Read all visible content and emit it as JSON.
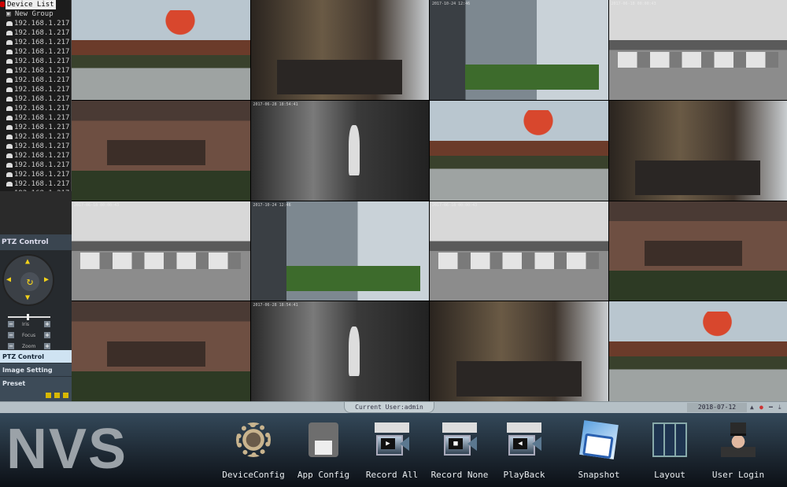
{
  "device_list": {
    "title": "Device List",
    "group": "New Group",
    "devices": [
      "192.168.1.217",
      "192.168.1.217",
      "192.168.1.217",
      "192.168.1.217",
      "192.168.1.217",
      "192.168.1.217",
      "192.168.1.217",
      "192.168.1.217",
      "192.168.1.217",
      "192.168.1.217",
      "192.168.1.217",
      "192.168.1.217",
      "192.168.1.217",
      "192.168.1.217",
      "192.168.1.217",
      "192.168.1.217",
      "192.168.1.217",
      "192.168.1.217",
      "192.168.1.217"
    ]
  },
  "ptz": {
    "header": "PTZ Control",
    "rows": [
      "Iris",
      "Focus",
      "Zoom"
    ],
    "tabs": [
      "PTZ Control",
      "Image Setting",
      "Preset"
    ]
  },
  "video_grid": {
    "tiles": [
      {
        "scene": "color-exterior"
      },
      {
        "scene": "color-lobby"
      },
      {
        "scene": "color-street",
        "timestamp": "2017-10-24 12:46"
      },
      {
        "scene": "ir-parking",
        "timestamp": "2017-06-18 00:00:43"
      },
      {
        "scene": "color-facade"
      },
      {
        "scene": "ir-office",
        "timestamp": "2017-06-28 18:54:41"
      },
      {
        "scene": "color-exterior"
      },
      {
        "scene": "color-lobby"
      },
      {
        "scene": "ir-parking",
        "timestamp": "2017-06-18 00:00:43"
      },
      {
        "scene": "color-street",
        "timestamp": "2017-10-24 12:46"
      },
      {
        "scene": "ir-parking",
        "timestamp": "2017-06-18 00:00:43"
      },
      {
        "scene": "color-facade"
      },
      {
        "scene": "color-facade"
      },
      {
        "scene": "ir-office",
        "timestamp": "2017-06-28 18:54:41"
      },
      {
        "scene": "color-lobby"
      },
      {
        "scene": "color-exterior"
      }
    ]
  },
  "status": {
    "current_user": "Current User:admin",
    "datetime": "2018-07-12 23:06:42"
  },
  "toolbar": {
    "logo": "NVS",
    "buttons": [
      {
        "label": "DeviceConfig",
        "icon": "gear-tools-icon"
      },
      {
        "label": "App Config",
        "icon": "floppy-disk-icon"
      },
      {
        "label": "Record All",
        "icon": "camera-record-icon"
      },
      {
        "label": "Record None",
        "icon": "camera-stop-icon"
      },
      {
        "label": "PlayBack",
        "icon": "camera-playback-icon"
      },
      {
        "label": "Snapshot",
        "icon": "snapshot-camera-icon"
      },
      {
        "label": "Layout",
        "icon": "layout-grid-icon"
      },
      {
        "label": "User Login",
        "icon": "user-tophat-icon"
      }
    ]
  }
}
